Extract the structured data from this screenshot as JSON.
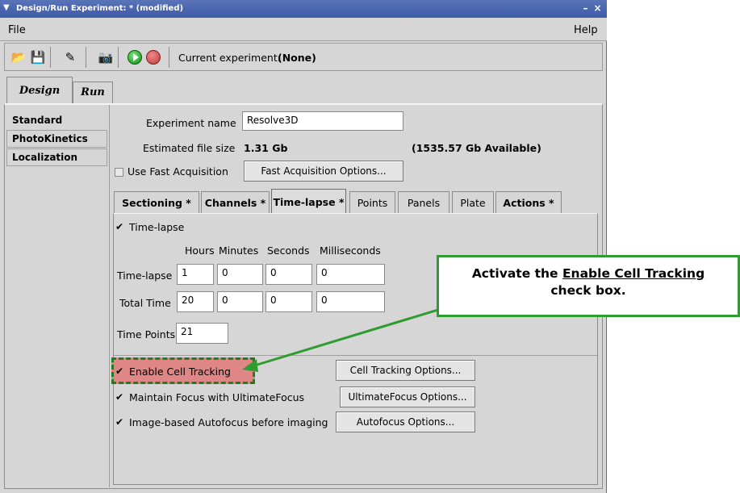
{
  "window": {
    "title": "Design/Run Experiment: * (modified)",
    "minimize": "–",
    "close": "×"
  },
  "menubar": {
    "file": "File",
    "help": "Help"
  },
  "toolbar": {
    "icons": [
      "open-icon",
      "save-icon",
      "clear-icon",
      "camera-icon",
      "play-icon",
      "stop-icon"
    ],
    "current_label": "Current experiment:",
    "current_value": "(None)"
  },
  "main_tabs": [
    "Design",
    "Run"
  ],
  "side_tabs": [
    "Standard",
    "PhotoKinetics",
    "Localization"
  ],
  "experiment": {
    "name_label": "Experiment name",
    "name_value": "Resolve3D",
    "size_label": "Estimated file size",
    "size_value": "1.31 Gb",
    "available": "(1535.57 Gb Available)",
    "fast_acq_label": "Use Fast Acquisition",
    "fast_acq_button": "Fast Acquisition Options..."
  },
  "inner_tabs": [
    "Sectioning *",
    "Channels *",
    "Time-lapse *",
    "Points",
    "Panels",
    "Plate",
    "Actions *"
  ],
  "timelapse": {
    "check_label": "Time-lapse",
    "headers": [
      "Hours",
      "Minutes",
      "Seconds",
      "Milliseconds"
    ],
    "rows": [
      {
        "label": "Time-lapse",
        "values": [
          "1",
          "0",
          "0",
          "0"
        ]
      },
      {
        "label": "Total Time",
        "values": [
          "20",
          "0",
          "0",
          "0"
        ]
      }
    ],
    "points_label": "Time Points",
    "points_value": "21"
  },
  "options": [
    {
      "label": "Enable Cell Tracking",
      "checked": true,
      "button": "Cell Tracking Options..."
    },
    {
      "label": "Maintain Focus with UltimateFocus",
      "checked": true,
      "button": "UltimateFocus Options..."
    },
    {
      "label": "Image-based Autofocus before imaging",
      "checked": true,
      "button": "Autofocus Options..."
    }
  ],
  "callout": {
    "line1_prefix": "Activate the ",
    "line1_link": "Enable Cell Tracking",
    "line2": "check box."
  },
  "colors": {
    "callout_border": "#2f9c2f",
    "highlight": "#e17878",
    "titlebar": "#3c5aa6"
  }
}
